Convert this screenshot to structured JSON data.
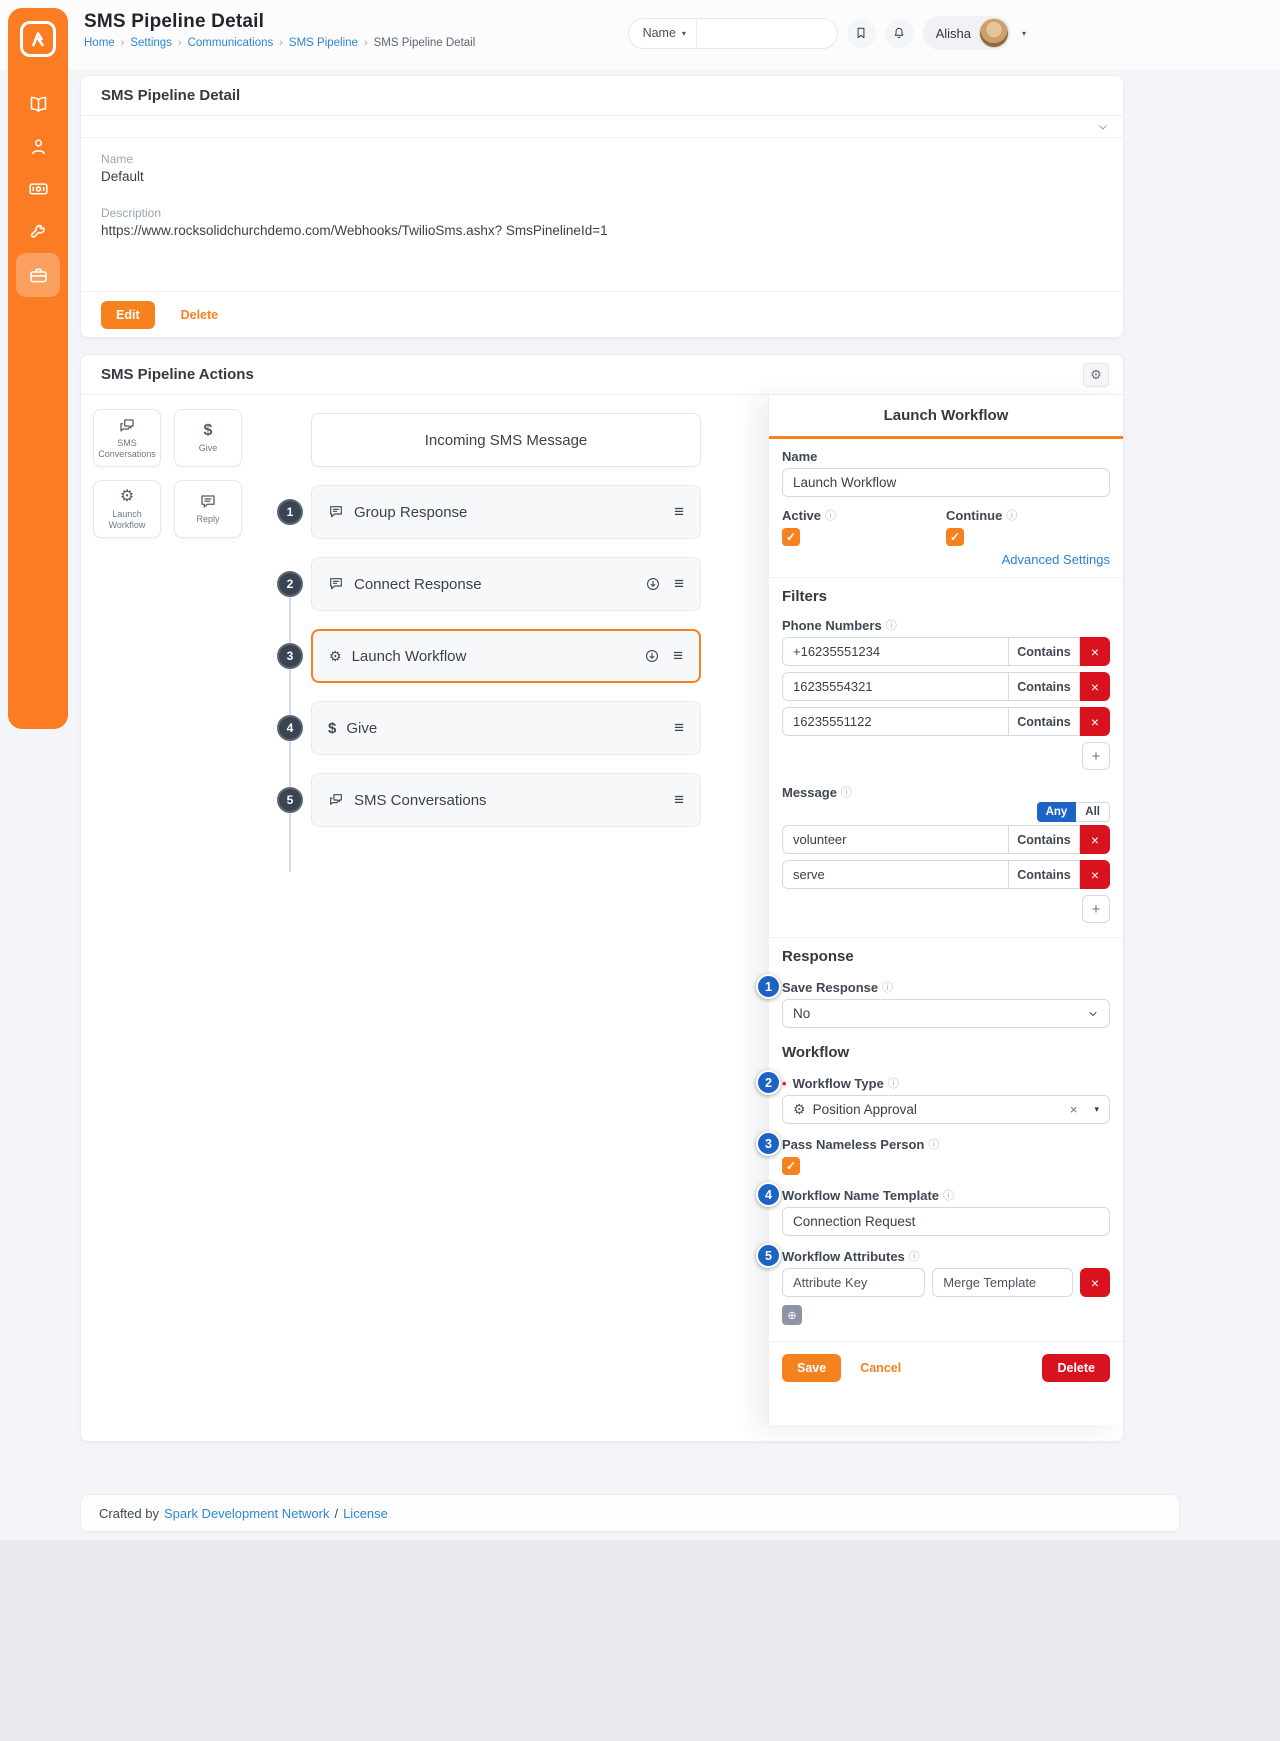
{
  "glyphs": {
    "gear": "⚙",
    "caret_down": "▾",
    "crumb_sep": "›",
    "hamburger": "≡",
    "plus": "+",
    "close": "×",
    "check": "✓",
    "info": "ⓘ",
    "circle_add": "⊕",
    "required_dot": "•",
    "dollar": "$"
  },
  "colors": {
    "accent_orange": "#f6821f",
    "sidebar_orange": "#fb7c23",
    "danger_red": "#d8131f",
    "link_blue": "#2b87d3",
    "toggle_blue": "#1e63c8"
  },
  "header": {
    "title": "SMS Pipeline Detail",
    "breadcrumb": [
      {
        "label": "Home"
      },
      {
        "label": "Settings"
      },
      {
        "label": "Communications"
      },
      {
        "label": "SMS Pipeline"
      },
      {
        "label": "SMS Pipeline Detail"
      }
    ],
    "search": {
      "filter_label": "Name",
      "input_value": ""
    },
    "user": {
      "name": "Alisha"
    }
  },
  "detail_panel": {
    "title": "SMS Pipeline Detail",
    "name_label": "Name",
    "name_value": "Default",
    "description_label": "Description",
    "description_value": "https://www.rocksolidchurchdemo.com/Webhooks/TwilioSms.ashx? SmsPinelineId=1",
    "edit_label": "Edit",
    "delete_label": "Delete"
  },
  "actions_panel": {
    "title": "SMS Pipeline Actions",
    "palette": [
      {
        "label": "SMS Conversations"
      },
      {
        "label": "Give"
      },
      {
        "label": "Launch Workflow"
      },
      {
        "label": "Reply"
      }
    ],
    "incoming_label": "Incoming SMS Message",
    "steps": [
      {
        "num": "1",
        "label": "Group Response"
      },
      {
        "num": "2",
        "label": "Connect Response"
      },
      {
        "num": "3",
        "label": "Launch Workflow"
      },
      {
        "num": "4",
        "label": "Give"
      },
      {
        "num": "5",
        "label": "SMS Conversations"
      }
    ]
  },
  "form": {
    "title": "Launch Workflow",
    "name_label": "Name",
    "name_value": "Launch Workflow",
    "active_label": "Active",
    "continue_label": "Continue",
    "advanced_settings_label": "Advanced Settings",
    "filters_heading": "Filters",
    "phone_numbers_label": "Phone Numbers",
    "contains_label": "Contains",
    "phone_rows": [
      {
        "value": "+16235551234"
      },
      {
        "value": "16235554321"
      },
      {
        "value": "16235551122"
      }
    ],
    "message_label": "Message",
    "any_label": "Any",
    "all_label": "All",
    "message_rows": [
      {
        "value": "volunteer"
      },
      {
        "value": "serve"
      }
    ],
    "response_heading": "Response",
    "save_response_label": "Save Response",
    "save_response_value": "No",
    "workflow_heading": "Workflow",
    "workflow_type_label": "Workflow Type",
    "workflow_type_value": "Position Approval",
    "pass_nameless_label": "Pass Nameless Person",
    "name_template_label": "Workflow Name Template",
    "name_template_value": "Connection Request",
    "attributes_label": "Workflow Attributes",
    "attribute_key_placeholder": "Attribute Key",
    "merge_template_placeholder": "Merge Template",
    "save_label": "Save",
    "cancel_label": "Cancel",
    "delete_label": "Delete"
  },
  "callouts": [
    "1",
    "2",
    "3",
    "4",
    "5"
  ],
  "footer": {
    "prefix": "Crafted by",
    "link1": "Spark Development Network",
    "separator": "/",
    "link2": "License"
  }
}
